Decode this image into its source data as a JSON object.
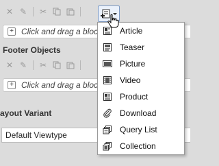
{
  "section1": {
    "dropzone_text": "Click and drag a block here"
  },
  "footer": {
    "title": "Footer Objects",
    "dropzone_text": "Click and drag a block here"
  },
  "layout": {
    "title": "ayout Variant",
    "select_value": "Default Viewtype"
  },
  "menu": {
    "items": [
      {
        "label": "Article",
        "icon": "article-icon"
      },
      {
        "label": "Teaser",
        "icon": "teaser-icon"
      },
      {
        "label": "Picture",
        "icon": "picture-icon"
      },
      {
        "label": "Video",
        "icon": "video-icon"
      },
      {
        "label": "Product",
        "icon": "product-icon"
      },
      {
        "label": "Download",
        "icon": "paperclip-icon"
      },
      {
        "label": "Query List",
        "icon": "query-list-icon"
      },
      {
        "label": "Collection",
        "icon": "collection-icon"
      }
    ]
  }
}
